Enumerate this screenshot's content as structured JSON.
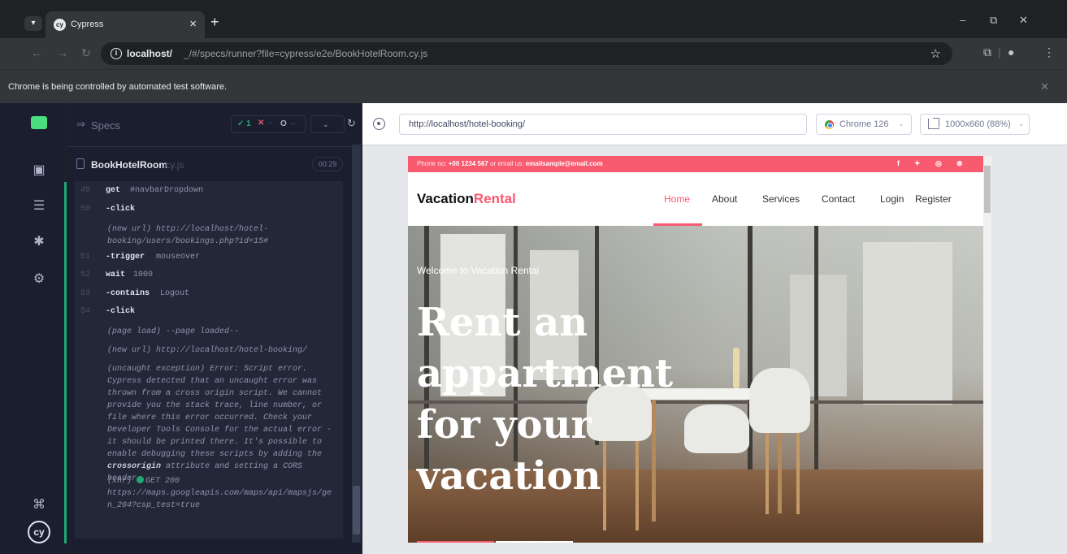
{
  "browser": {
    "tab_title": "Cypress",
    "tab_close": "×",
    "new_tab": "+",
    "menu_icon": "chevron-down-icon",
    "win_minimize": "–",
    "win_restore": "⧉",
    "win_close": "✕",
    "url_host": "localhost/",
    "url_path": "_/#/specs/runner?file=cypress/e2e/BookHotelRoom.cy.js",
    "automation_notice": "Chrome is being controlled by automated test software."
  },
  "rail": {
    "items": [
      "specs-icon",
      "runs-icon",
      "debug-icon",
      "settings-icon"
    ],
    "shortcut_icon": "⌘",
    "cy_logo": "cy"
  },
  "reporter": {
    "specs_label": "Specs",
    "passed": "✓ 1",
    "failed": "✕",
    "failed_count": "--",
    "pending": "O",
    "pending_count": "--",
    "spec_name": "BookHotelRoom",
    "spec_ext": ".cy.js",
    "spec_time": "00:29",
    "commands": [
      {
        "num": "49",
        "name": "get",
        "msg": "#navbarDropdown"
      },
      {
        "num": "50",
        "name": "-click",
        "msg": ""
      },
      {
        "num": "51",
        "name": "-trigger",
        "msg": "mouseover"
      },
      {
        "num": "52",
        "name": "wait",
        "msg": "1000"
      },
      {
        "num": "53",
        "name": "-contains",
        "msg": "Logout"
      },
      {
        "num": "54",
        "name": "-click",
        "msg": ""
      }
    ],
    "note_new_url_1": "(new url)  http://localhost/hotel-booking/users/bookings.php?id=15#",
    "note_page_load": "(page load)  --page loaded--",
    "note_new_url_2": "(new url)  http://localhost/hotel-booking/",
    "note_exception_pre": "(uncaught exception)  Error: Script error. Cypress detected that an uncaught error was thrown from a cross origin script. We cannot provide you the stack trace, line number, or file where this error occurred. Check your Developer Tools Console for the actual error - it should be printed there. It's possible to enable debugging these scripts by adding the",
    "note_exception_bold": "crossorigin",
    "note_exception_post": "attribute and setting a CORS header.",
    "xhr_label": "(xhr)",
    "xhr_status": "GET 200",
    "xhr_url": "https://maps.googleapis.com/maps/api/mapsjs/gen_204?csp_test=true"
  },
  "aut": {
    "url": "http://localhost/hotel-booking/",
    "browser": "Chrome 126",
    "viewport": "1000x660 (88%)"
  },
  "site": {
    "topbar_prefix": "Phone no:",
    "phone": "+00 1234 567",
    "topbar_mid": "or email us:",
    "email": "emailsample@email.com",
    "brand_main": "Vacation",
    "brand_accent": "Rental",
    "nav": [
      "Home",
      "About",
      "Services",
      "Contact",
      "Login",
      "Register"
    ],
    "welcome": "Welcome to Vacation Rental",
    "hero_title": "Rent an appartment for your vacation",
    "social": [
      "f",
      "🐦",
      "◎",
      "⊛"
    ]
  },
  "colors": {
    "accent": "#f85a70",
    "pass": "#1fa971",
    "fail": "#e45770"
  }
}
